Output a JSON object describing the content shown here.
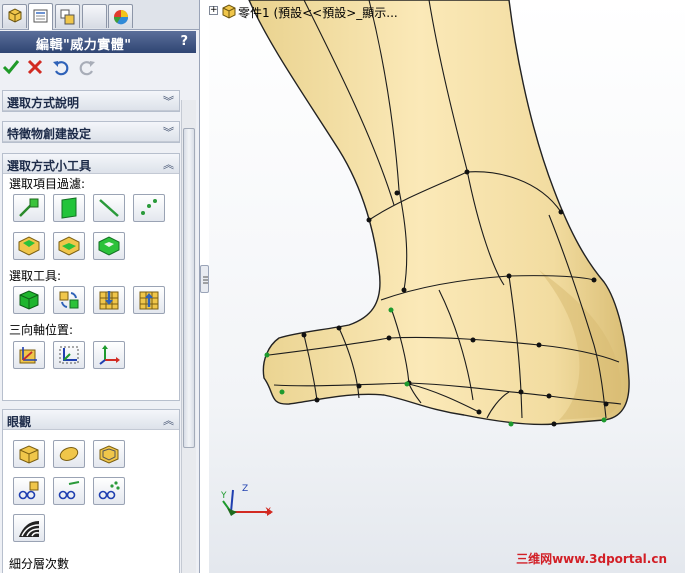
{
  "panel": {
    "title": "編輯\"威力實體\"",
    "help": "?",
    "tabs": [
      "feature-manager-icon",
      "property-manager-icon",
      "configuration-manager-icon",
      "blank-tab",
      "display-manager-icon"
    ]
  },
  "actions": [
    "ok-check-icon",
    "cancel-x-icon",
    "undo-icon",
    "redo-icon"
  ],
  "sections": {
    "selection_help": {
      "label": "選取方式說明",
      "state": "collapsed"
    },
    "feature_settings": {
      "label": "特徵物創建設定",
      "state": "collapsed"
    },
    "selection_tools": {
      "label": "選取方式小工具",
      "state": "expanded",
      "filter_label": "選取項目過濾:",
      "tools_label": "選取工具:",
      "triad_label": "三向軸位置:"
    },
    "view": {
      "label": "眼觀",
      "state": "expanded",
      "subdivision_label": "細分層次數"
    }
  },
  "graphics": {
    "tree_text": "零件1  (預設<<預設>_顯示...",
    "watermark": "三维网www.3dportal.cn",
    "triad": {
      "x": "X",
      "y": "Y",
      "z": "Z"
    }
  },
  "colors": {
    "model_fill": "#f2dfa3",
    "title_bar": "#2f4573",
    "watermark": "#d21f26"
  }
}
